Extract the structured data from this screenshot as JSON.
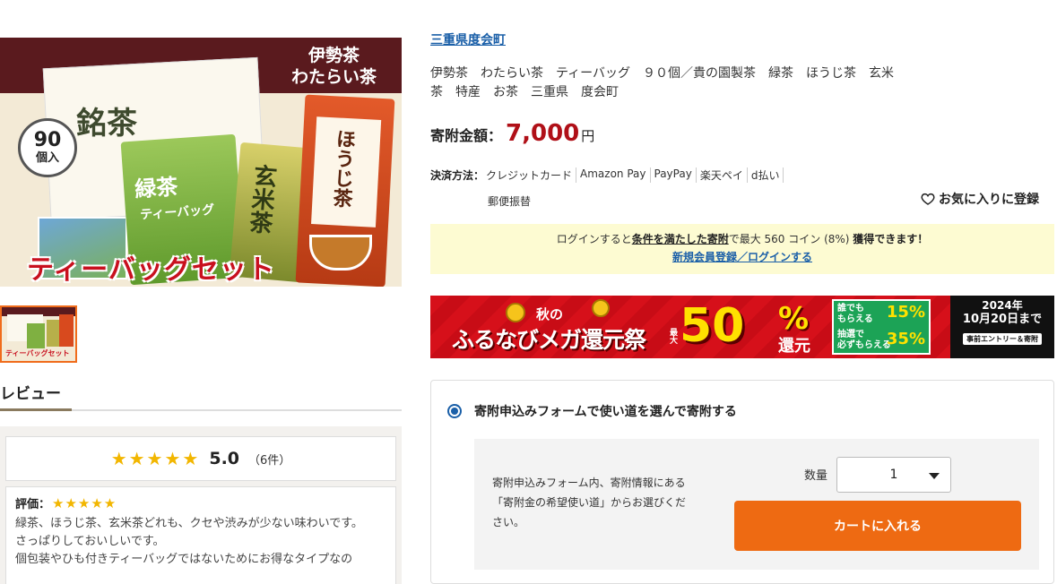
{
  "product_image": {
    "brand_text": "伊勢茶\nわたらい茶",
    "badge_number": "90",
    "badge_unit": "個入",
    "box_label": "銘茶",
    "bag_green_label": "緑茶",
    "bag_green_sub": "ティーバッグ",
    "bag_yellow_label": "玄米茶",
    "bag_orange_label": "ほうじ茶",
    "caption": "ティーバッグセット"
  },
  "thumbnail": {
    "caption": "ティーバッグセット"
  },
  "reviews": {
    "heading": "レビュー",
    "stars": "★★★★★",
    "average": "5.0",
    "count": "（6件）",
    "items": [
      {
        "rating_label": "評価：",
        "stars": "★★★★★",
        "body": "緑茶、ほうじ茶、玄米茶どれも、クセや渋みが少ない味わいです。\nさっぱりしておいしいです。\n個包装やひも付きティーバッグではないためにお得なタイプなの"
      }
    ]
  },
  "product": {
    "region": "三重県度会町",
    "title": "伊勢茶　わたらい茶　ティーバッグ　９０個／貴の園製茶　緑茶　ほうじ茶　玄米茶　特産　お茶　三重県　度会町",
    "price_label": "寄附金額",
    "price_colon": "：",
    "price_value": "7,000",
    "price_unit": "円"
  },
  "payment": {
    "label": "決済方法：",
    "methods": [
      "クレジットカード",
      "Amazon Pay",
      "PayPay",
      "楽天ペイ",
      "d払い",
      "郵便振替"
    ]
  },
  "favorite": {
    "label": "お気に入りに登録"
  },
  "login_notice": {
    "prefix": "ログインすると",
    "condition_link": "条件を満たした寄附",
    "middle": "で最大 560 コイン (8%) ",
    "earn": "獲得できます！",
    "register_link": "新規会員登録／ログインする"
  },
  "banner": {
    "autumn": "秋の",
    "campaign": "ふるなびメガ還元祭",
    "max": "最大",
    "percent_number": "50",
    "percent_sign": "%",
    "kangen": "還元",
    "deal_everyone": "誰でも\nもらえる",
    "deal_everyone_value": "15%",
    "deal_lottery": "抽選で\n必ずもらえる",
    "deal_lottery_value": "35%",
    "year": "2024年",
    "until": "10月20日まで",
    "entry": "事前エントリー＆寄附"
  },
  "donation_form": {
    "option_label": "寄附申込みフォームで使い道を選んで寄附する",
    "instructions": "寄附申込みフォーム内、寄附情報にある「寄附金の希望使い道」からお選びください。",
    "quantity_label": "数量",
    "quantity_value": "1",
    "cart_button": "カートに入れる"
  },
  "colors": {
    "accent_orange": "#ee6a12",
    "price_red": "#b01018",
    "link_blue": "#1a5fa8",
    "star_gold": "#f2b600"
  }
}
